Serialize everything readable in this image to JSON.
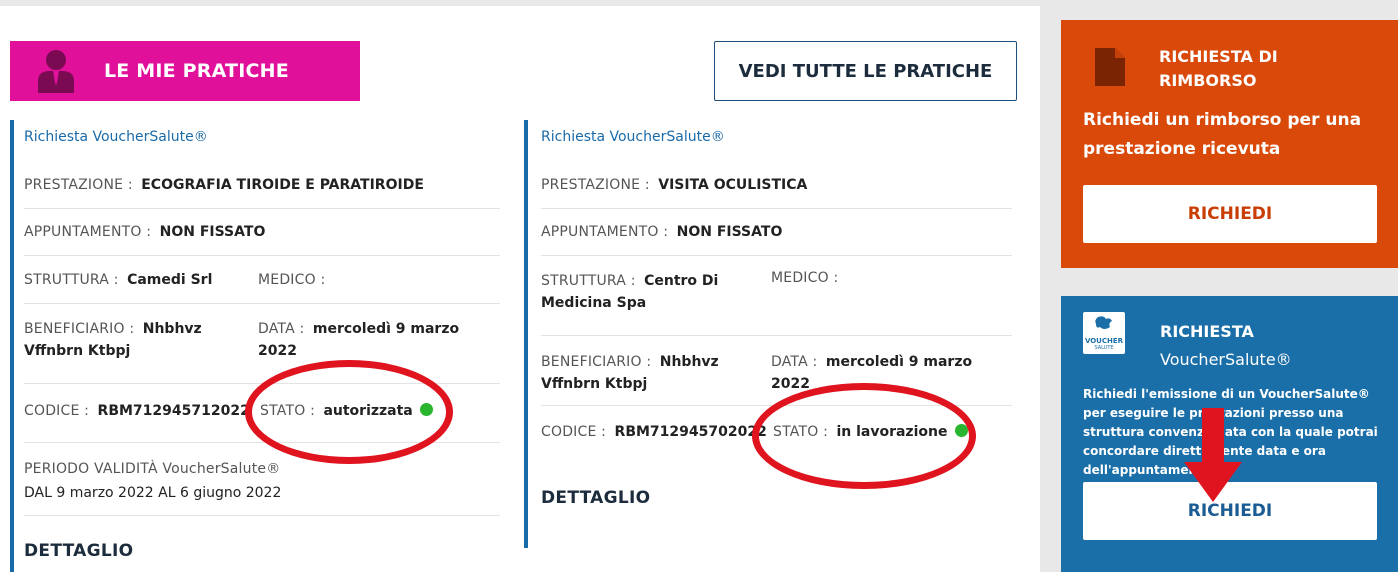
{
  "header": {
    "section_title": "LE MIE PRATICHE",
    "view_all_label": "VEDI TUTTE LE PRATICHE"
  },
  "practices": [
    {
      "type": "Richiesta VoucherSalute®",
      "prestazione_label": "PRESTAZIONE :",
      "prestazione_value": "ECOGRAFIA TIROIDE E PARATIROIDE",
      "appuntamento_label": "APPUNTAMENTO :",
      "appuntamento_value": "NON FISSATO",
      "struttura_label": "STRUTTURA :",
      "struttura_value": "Camedi Srl",
      "medico_label": "MEDICO :",
      "medico_value": "",
      "beneficiario_label": "BENEFICIARIO :",
      "beneficiario_value": "Nhbhvz Vffnbrn Ktbpj",
      "data_label": "DATA :",
      "data_value": "mercoledì 9 marzo 2022",
      "codice_label": "CODICE :",
      "codice_value": "RBM712945712022",
      "stato_label": "STATO :",
      "stato_value": "autorizzata",
      "validita_label": "PERIODO VALIDITÀ VoucherSalute®",
      "validita_value": "DAL 9 marzo 2022 AL 6 giugno 2022",
      "detail_label": "DETTAGLIO"
    },
    {
      "type": "Richiesta VoucherSalute®",
      "prestazione_label": "PRESTAZIONE :",
      "prestazione_value": "VISITA OCULISTICA",
      "appuntamento_label": "APPUNTAMENTO :",
      "appuntamento_value": "NON FISSATO",
      "struttura_label": "STRUTTURA :",
      "struttura_value": "Centro Di Medicina Spa",
      "medico_label": "MEDICO :",
      "medico_value": "",
      "beneficiario_label": "BENEFICIARIO :",
      "beneficiario_value": "Nhbhvz Vffnbrn Ktbpj",
      "data_label": "DATA :",
      "data_value": "mercoledì 9 marzo 2022",
      "codice_label": "CODICE :",
      "codice_value": "RBM712945702022",
      "stato_label": "STATO :",
      "stato_value": "in lavorazione",
      "detail_label": "DETTAGLIO"
    }
  ],
  "rimborso": {
    "title_line1": "RICHIESTA DI",
    "title_line2": "RIMBORSO",
    "description": "Richiedi un rimborso per una prestazione ricevuta",
    "button": "RICHIEDI"
  },
  "voucher": {
    "title_line1": "RICHIESTA",
    "title_line2": "VoucherSalute®",
    "logo_text": "VOUCHER",
    "logo_subtext": "SALUTE",
    "description": "Richiedi l'emissione di un VoucherSalute® per eseguire le prestazioni presso una struttura convenzionata con la quale potrai concordare direttamente data e ora dell'appuntamento",
    "button": "RICHIEDI"
  },
  "colors": {
    "magenta": "#e0109a",
    "blue_accent": "#166ba8",
    "orange": "#d94a0a",
    "voucher_blue": "#1b6fa8",
    "status_green": "#2ab530",
    "annotation_red": "#e0141e"
  }
}
